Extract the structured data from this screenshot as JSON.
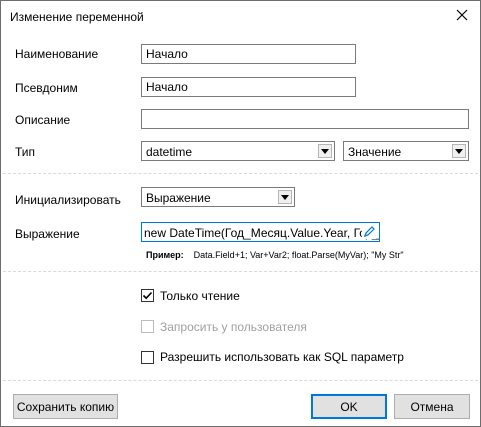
{
  "window": {
    "title": "Изменение переменной"
  },
  "fields": {
    "name": {
      "label": "Наименование",
      "value": "Начало"
    },
    "alias": {
      "label": "Псевдоним",
      "value": "Начало"
    },
    "description": {
      "label": "Описание",
      "value": ""
    },
    "type": {
      "label": "Тип",
      "selected": "datetime",
      "mode_selected": "Значение"
    }
  },
  "init": {
    "label": "Инициализировать",
    "selected": "Выражение",
    "expression_label": "Выражение",
    "expression_value": "new DateTime(Год_Месяц.Value.Year, Год_",
    "example_label": "Пример:",
    "example_text": "Data.Field+1; Var+Var2; float.Parse(MyVar); \"My Str\""
  },
  "options": {
    "readonly": {
      "label": "Только чтение",
      "checked": true,
      "enabled": true
    },
    "ask_user": {
      "label": "Запросить у пользователя",
      "checked": false,
      "enabled": false
    },
    "sql_param": {
      "label": "Разрешить использовать как SQL параметр",
      "checked": false,
      "enabled": true
    }
  },
  "buttons": {
    "save_copy": "Сохранить копию",
    "ok": "OK",
    "cancel": "Отмена"
  },
  "icons": {
    "close": "close-icon",
    "dropdown": "chevron-down-icon",
    "edit": "pencil-icon",
    "check": "checkmark-icon"
  },
  "colors": {
    "focus_border": "#0078d7",
    "disabled_text": "#a0a0a0"
  }
}
